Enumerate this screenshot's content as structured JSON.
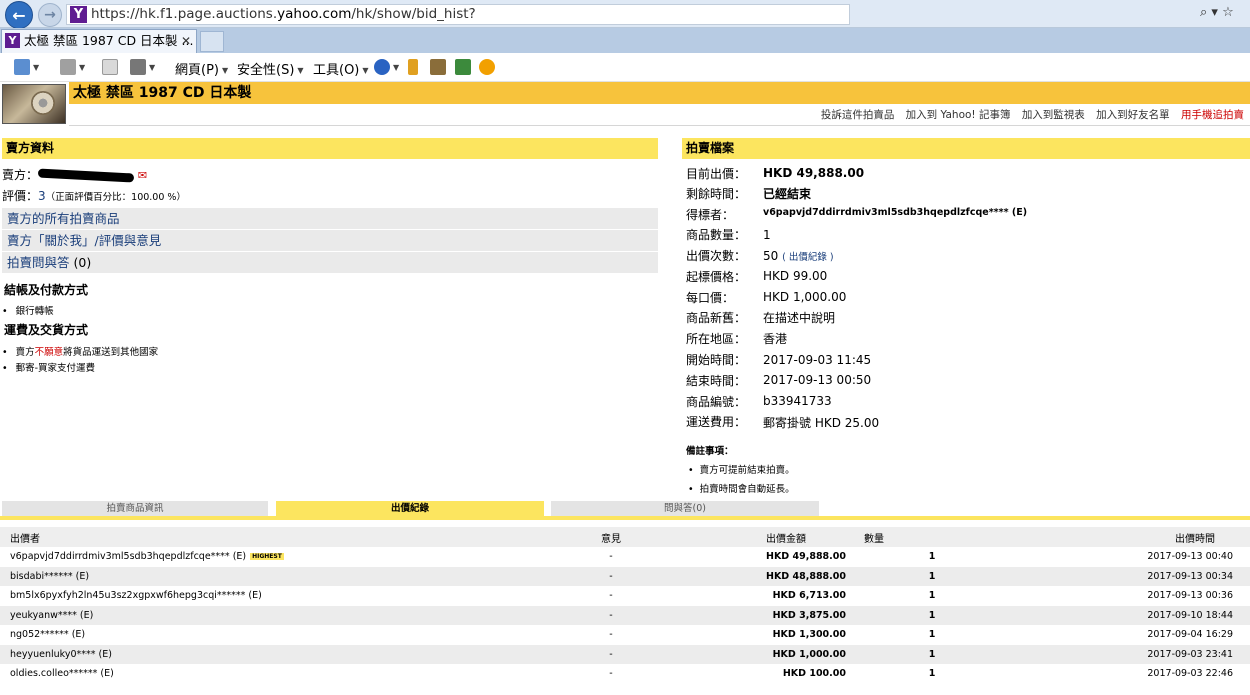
{
  "browser": {
    "url_prefix": "https://hk.f1.page.auctions.",
    "url_domain": "yahoo.com",
    "url_suffix": "/hk/show/bid_hist?",
    "tab_title": "太極 禁區 1987 CD 日本製 ...",
    "search_glyph": "⌕ ▾ ☆"
  },
  "toolbar": {
    "page_menu": "網頁(P)",
    "safety_menu": "安全性(S)",
    "tools_menu": "工具(O)"
  },
  "item": {
    "title": "太極 禁區 1987 CD 日本製",
    "links": [
      "投訴這件拍賣品",
      "加入到 Yahoo! 記事簿",
      "加入到監視表",
      "加入到好友名單",
      "用手機追拍賣"
    ]
  },
  "seller": {
    "section_title": "賣方資料",
    "label_seller": "賣方：",
    "label_rating": "評價：",
    "rating_value": "3",
    "rating_note": "（正面評價百分比：100.00 %）",
    "links": [
      "賣方的所有拍賣商品",
      "賣方「關於我」/評價與意見"
    ],
    "qa_label": "拍賣問與答",
    "qa_count": "(0)",
    "payment_title": "結帳及付款方式",
    "payment_items": [
      "銀行轉帳"
    ],
    "shipping_title": "運費及交貨方式",
    "shipping_prefix": "賣方",
    "shipping_red": "不願意",
    "shipping_suffix": "將貨品運送到其他國家",
    "shipping_items": [
      "郵寄-買家支付運費"
    ]
  },
  "auction": {
    "section_title": "拍賣檔案",
    "fields": [
      {
        "label": "目前出價：",
        "value": "HKD 49,888.00"
      },
      {
        "label": "剩餘時間：",
        "value": "已經結束"
      },
      {
        "label": "得標者：",
        "value": "v6papvjd7ddirrdmiv3ml5sdb3hqepdlzfcqe**** (E)"
      },
      {
        "label": "商品數量：",
        "value": "1"
      },
      {
        "label": "出價次數：",
        "value": "50"
      },
      {
        "label": "起標價格：",
        "value": "HKD 99.00"
      },
      {
        "label": "每口價：",
        "value": "HKD 1,000.00"
      },
      {
        "label": "商品新舊：",
        "value": "在描述中說明"
      },
      {
        "label": "所在地區：",
        "value": "香港"
      },
      {
        "label": "開始時間：",
        "value": "2017-09-03 11:45"
      },
      {
        "label": "結束時間：",
        "value": "2017-09-13 00:50"
      },
      {
        "label": "商品編號：",
        "value": "b33941733"
      },
      {
        "label": "運送費用：",
        "value": "郵寄掛號 HKD 25.00"
      }
    ],
    "bid_record_link": "( 出價紀錄 )",
    "notes_title": "備註事項：",
    "notes": [
      "賣方可提前結束拍賣。",
      "拍賣時間會自動延長。"
    ]
  },
  "tabs": [
    "拍賣商品資訊",
    "出價紀錄",
    "問與答(0)"
  ],
  "bids": {
    "headers": [
      "出價者",
      "意見",
      "出價金額",
      "數量",
      "出價時間"
    ],
    "highest_label": "HIGHEST",
    "rows": [
      {
        "user": "v6papvjd7ddirrdmiv3ml5sdb3hqepdlzfcqe****  (E)",
        "note": "-",
        "amount": "HKD 49,888.00",
        "qty": "1",
        "time": "2017-09-13 00:40"
      },
      {
        "user": "bisdabi******  (E)",
        "note": "-",
        "amount": "HKD 48,888.00",
        "qty": "1",
        "time": "2017-09-13 00:34"
      },
      {
        "user": "bm5lx6pyxfyh2ln45u3sz2xgpxwf6hepg3cqi******  (E)",
        "note": "-",
        "amount": "HKD 6,713.00",
        "qty": "1",
        "time": "2017-09-13 00:36"
      },
      {
        "user": "yeukyanw****  (E)",
        "note": "-",
        "amount": "HKD 3,875.00",
        "qty": "1",
        "time": "2017-09-10 18:44"
      },
      {
        "user": "ng052******  (E)",
        "note": "-",
        "amount": "HKD 1,300.00",
        "qty": "1",
        "time": "2017-09-04 16:29"
      },
      {
        "user": "heyyuenluky0****  (E)",
        "note": "-",
        "amount": "HKD 1,000.00",
        "qty": "1",
        "time": "2017-09-03 23:41"
      },
      {
        "user": "oldies.colleo******  (E)",
        "note": "-",
        "amount": "HKD 100.00",
        "qty": "1",
        "time": "2017-09-03 22:46"
      }
    ]
  }
}
